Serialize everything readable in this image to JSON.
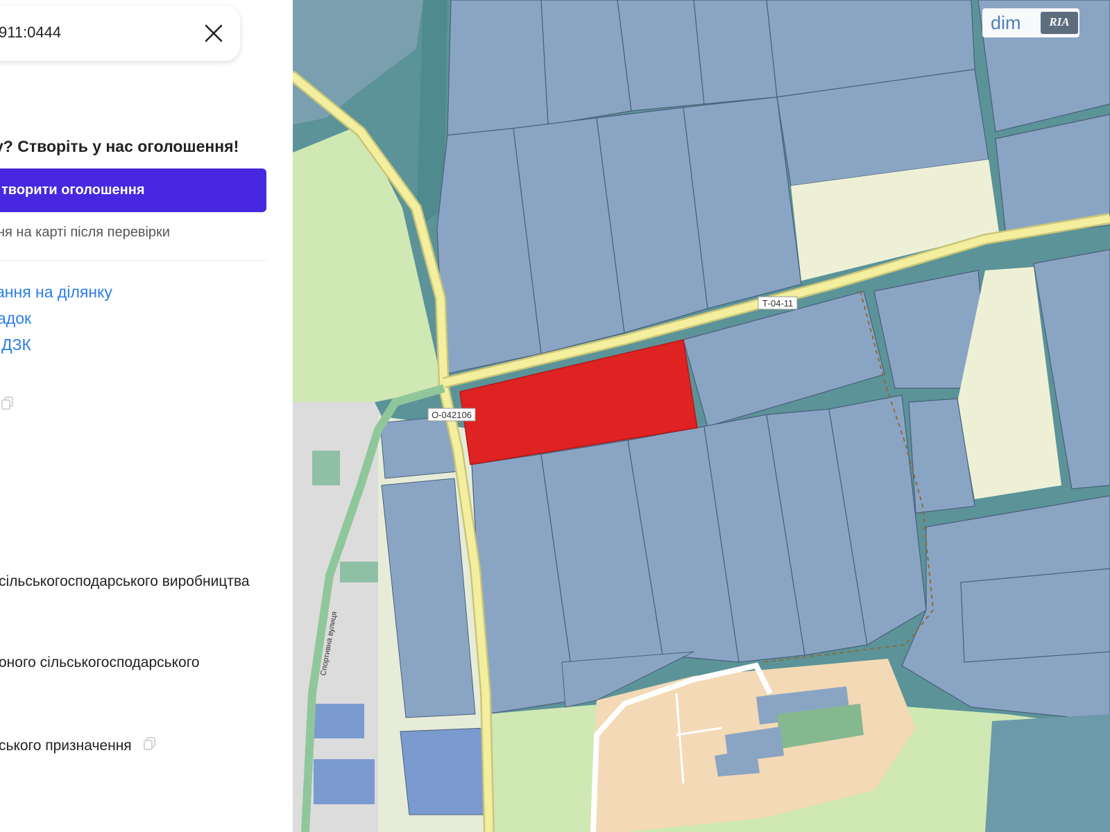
{
  "search": {
    "query": "911:0444"
  },
  "promo": {
    "title": "у? Створіть у нас оголошення!",
    "button_label": "творити оголошення",
    "note": "ня на карті після перевірки"
  },
  "links": [
    {
      "label": "ання на ділянку"
    },
    {
      "label": "адок"
    },
    {
      "label": "ДЗК"
    }
  ],
  "purposes": [
    {
      "text": "сільськогосподарського виробництва"
    },
    {
      "text": "оного сільськогосподарського"
    },
    {
      "text": "ського призначення"
    }
  ],
  "map": {
    "road_labels": [
      "Т-04-11",
      "О-042106"
    ],
    "street_label": "Спортивна вулиця",
    "colors": {
      "parcel": "#8aa5c4",
      "selected_parcel": "#df2222",
      "road": "#f4ef9e",
      "meadow": "#cfe8b4",
      "fallow": "#eef0d6",
      "village": "#f3d9b5",
      "teal": "#5b9398"
    }
  },
  "logo": {
    "dim": "dim",
    "ria": "RIA"
  }
}
